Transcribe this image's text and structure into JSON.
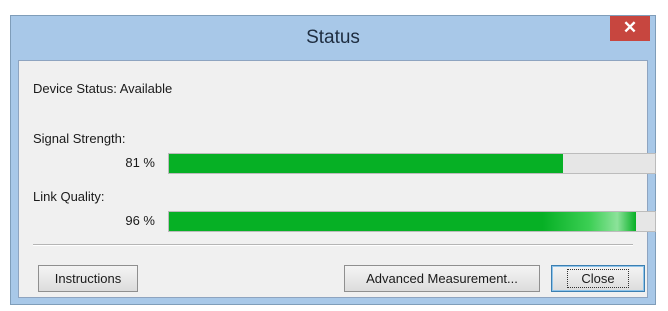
{
  "window": {
    "title": "Status",
    "close_glyph": "✕"
  },
  "device_status": "Device Status: Available",
  "signal": {
    "label": "Signal Strength:",
    "percent_text": "81 %",
    "value": 0.81
  },
  "link": {
    "label": "Link Quality:",
    "percent_text": "96 %",
    "value": 0.96
  },
  "buttons": {
    "instructions": "Instructions",
    "advanced": "Advanced Measurement...",
    "close": "Close"
  },
  "colors": {
    "progress_green": "#06b025",
    "close_red": "#c7463f"
  },
  "icons": {
    "close": "close-icon"
  }
}
